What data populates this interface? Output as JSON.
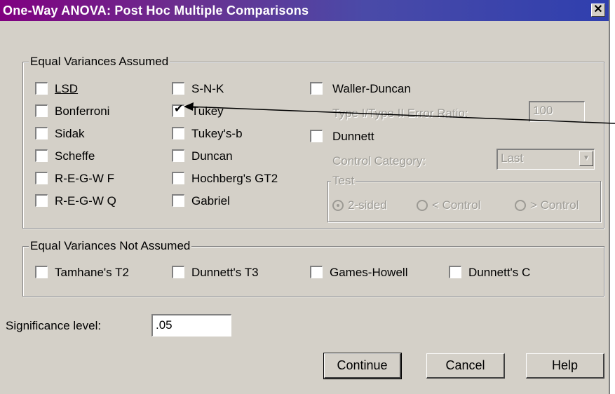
{
  "window": {
    "title": "One-Way ANOVA: Post Hoc Multiple Comparisons",
    "close_glyph": "✕"
  },
  "equal": {
    "legend": "Equal Variances Assumed",
    "col1": [
      {
        "label": "LSD",
        "checked": false
      },
      {
        "label": "Bonferroni",
        "checked": false
      },
      {
        "label": "Sidak",
        "checked": false
      },
      {
        "label": "Scheffe",
        "checked": false
      },
      {
        "label": "R-E-G-W F",
        "checked": false
      },
      {
        "label": "R-E-G-W Q",
        "checked": false
      }
    ],
    "col2": [
      {
        "label": "S-N-K",
        "checked": false
      },
      {
        "label": "Tukey",
        "checked": true
      },
      {
        "label": "Tukey's-b",
        "checked": false
      },
      {
        "label": "Duncan",
        "checked": false
      },
      {
        "label": "Hochberg's GT2",
        "checked": false
      },
      {
        "label": "Gabriel",
        "checked": false
      }
    ],
    "waller": {
      "label": "Waller-Duncan",
      "checked": false
    },
    "error_ratio_label": "Type I/Type II Error Ratio:",
    "error_ratio_value": "100",
    "dunnett": {
      "label": "Dunnett",
      "checked": false
    },
    "control_label": "Control Category:",
    "control_value": "Last",
    "test": {
      "legend": "Test",
      "options": [
        "2-sided",
        "< Control",
        "> Control"
      ],
      "selected": "2-sided"
    }
  },
  "notequal": {
    "legend": "Equal Variances Not Assumed",
    "items": [
      {
        "label": "Tamhane's T2",
        "checked": false
      },
      {
        "label": "Dunnett's T3",
        "checked": false
      },
      {
        "label": "Games-Howell",
        "checked": false
      },
      {
        "label": "Dunnett's C",
        "checked": false
      }
    ]
  },
  "significance": {
    "label": "Significance level:",
    "value": ".05"
  },
  "buttons": {
    "continue": "Continue",
    "cancel": "Cancel",
    "help": "Help"
  },
  "check_glyph": "✔"
}
